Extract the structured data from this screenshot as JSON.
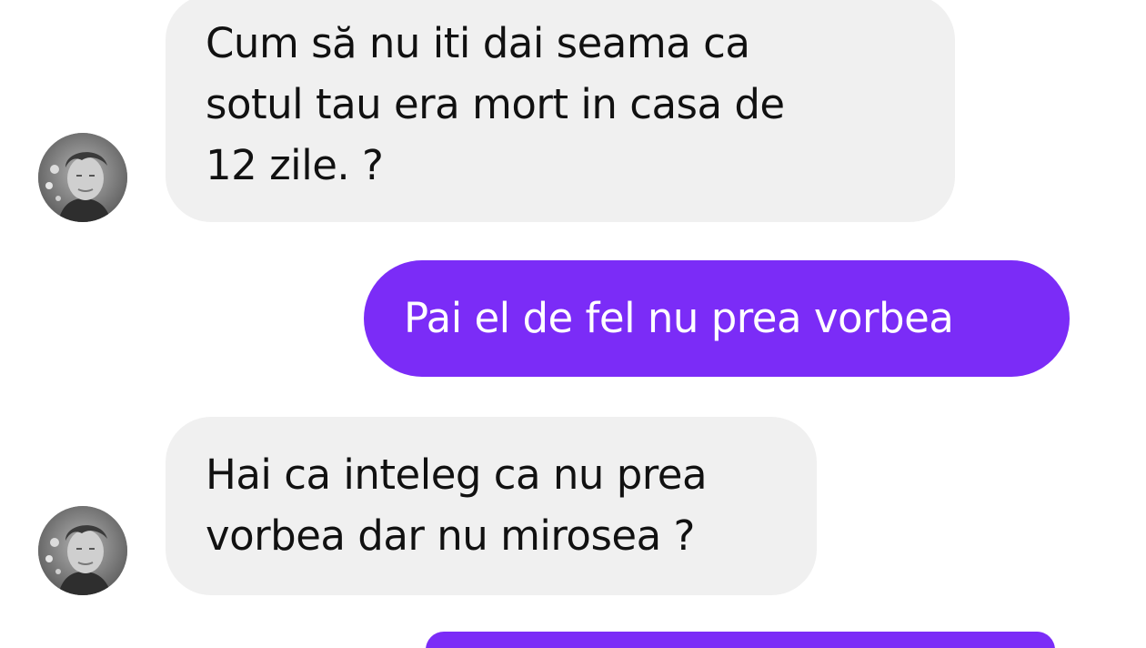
{
  "theme": {
    "outgoing_color": "#7b2cf7",
    "incoming_color": "#f0f0f0"
  },
  "messages": [
    {
      "direction": "incoming",
      "lines": [
        "Cum să nu iti dai seama ca",
        "sotul tau era mort in casa de",
        "12 zile. ?"
      ],
      "avatar": "contact-avatar"
    },
    {
      "direction": "outgoing",
      "lines": [
        "Pai el de fel nu prea vorbea"
      ]
    },
    {
      "direction": "incoming",
      "lines": [
        "Hai ca inteleg ca nu prea",
        "vorbea dar nu mirosea ?"
      ],
      "avatar": "contact-avatar"
    },
    {
      "direction": "outgoing",
      "lines": [
        ""
      ]
    }
  ]
}
